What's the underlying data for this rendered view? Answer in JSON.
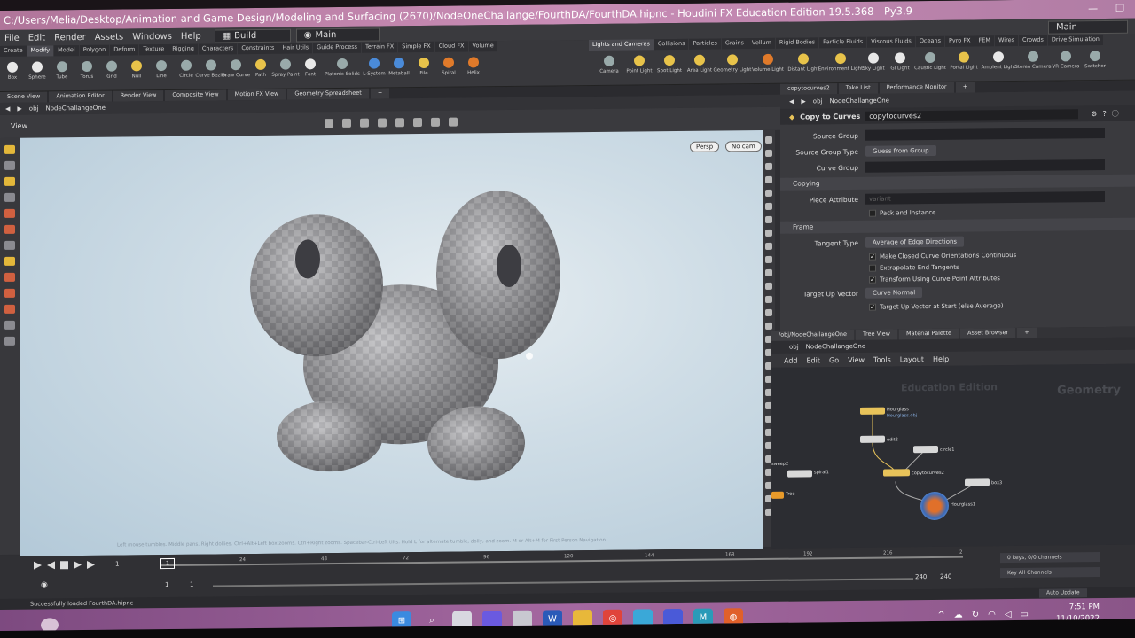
{
  "window": {
    "title": "C:/Users/Melia/Desktop/Animation and Game Design/Modeling and Surfacing (2670)/NodeOneChallange/FourthDA/FourthDA.hipnc - Houdini FX Education Edition 19.5.368 - Py3.9"
  },
  "menu": {
    "items": [
      "File",
      "Edit",
      "Render",
      "Assets",
      "Windows",
      "Help"
    ],
    "desktop_label": "Build",
    "desktop2_label": "Main",
    "right_label": "Main"
  },
  "shelf": {
    "left_tabs": [
      "Create",
      "Modify",
      "Model",
      "Polygon",
      "Deform",
      "Texture",
      "Rigging",
      "Characters",
      "Constraints",
      "Hair Utils",
      "Guide Process",
      "Terrain FX",
      "Simple FX",
      "Cloud FX",
      "Volume"
    ],
    "left_tools": [
      "Box",
      "Sphere",
      "Tube",
      "Torus",
      "Grid",
      "Null",
      "Line",
      "Circle",
      "Curve Bezier",
      "Draw Curve",
      "Path",
      "Spray Paint",
      "Font",
      "Platonic Solids",
      "L-System",
      "Metaball",
      "File",
      "Spiral",
      "Helix"
    ],
    "right_tabs": [
      "Lights and Cameras",
      "Collisions",
      "Particles",
      "Grains",
      "Vellum",
      "Rigid Bodies",
      "Particle Fluids",
      "Viscous Fluids",
      "Oceans",
      "Pyro FX",
      "FEM",
      "Wires",
      "Crowds",
      "Drive Simulation"
    ],
    "right_tools": [
      "Camera",
      "Point Light",
      "Spot Light",
      "Area Light",
      "Geometry Light",
      "Volume Light",
      "Distant Light",
      "Environment Light",
      "Sky Light",
      "GI Light",
      "Caustic Light",
      "Portal Light",
      "Ambient Light",
      "Stereo Camera",
      "VR Camera",
      "Switcher"
    ]
  },
  "panetabs": [
    "Scene View",
    "Animation Editor",
    "Render View",
    "Composite View",
    "Motion FX View",
    "Geometry Spreadsheet"
  ],
  "path": {
    "context": "obj",
    "node": "NodeChallangeOne"
  },
  "viewport": {
    "label": "View",
    "persp": "Persp",
    "cam": "No cam",
    "hint": "Left mouse tumbles. Middle pans. Right dollies. Ctrl+Alt+Left box zooms. Ctrl+Right zooms. Spacebar-Ctrl-Left tilts. Hold L for alternate tumble, dolly, and zoom.    M or Alt+M for First Person Navigation."
  },
  "parms": {
    "tabs": [
      "copytocurves2",
      "Take List",
      "Performance Monitor"
    ],
    "path_context": "obj",
    "path_node": "NodeChallangeOne",
    "node_type": "Copy to Curves",
    "node_name": "copytocurves2",
    "source_group_label": "Source Group",
    "source_group_type_label": "Source Group Type",
    "source_group_type_value": "Guess from Group",
    "curve_group_label": "Curve Group",
    "section_copying": "Copying",
    "piece_attribute_label": "Piece Attribute",
    "piece_attribute_value": "variant",
    "pack_instance": "Pack and Instance",
    "section_frame": "Frame",
    "tangent_type_label": "Tangent Type",
    "tangent_type_value": "Average of Edge Directions",
    "cb1": "Make Closed Curve Orientations Continuous",
    "cb2": "Extrapolate End Tangents",
    "cb3": "Transform Using Curve Point Attributes",
    "target_up_label": "Target Up Vector",
    "target_up_value": "Curve Normal",
    "cb4": "Target Up Vector at Start (else Average)"
  },
  "network": {
    "tabs": [
      "/obj/NodeChallangeOne",
      "Tree View",
      "Material Palette",
      "Asset Browser"
    ],
    "path_context": "obj",
    "path_node": "NodeChallangeOne",
    "menu": [
      "Add",
      "Edit",
      "Go",
      "View",
      "Tools",
      "Layout",
      "Help"
    ],
    "watermark1": "Education Edition",
    "watermark2": "Geometry",
    "nodes": {
      "file": "Hourglass",
      "file_sub": "Hourglass.obj",
      "edit": "edit2",
      "circle": "circle1",
      "copy": "copytocurves2",
      "spiral": "spiral1",
      "box": "box3",
      "hg": "Hourglass1",
      "tree": "Tree",
      "sweep": "sweep2"
    }
  },
  "timeline": {
    "current": "1",
    "ticks": [
      "24",
      "48",
      "72",
      "96",
      "120",
      "144",
      "168",
      "192",
      "216",
      "2"
    ],
    "start": "1",
    "start2": "1",
    "end": "240",
    "end2": "240",
    "keys": "0 keys, 0/0 channels",
    "key_all": "Key All Channels",
    "auto_update": "Auto Update"
  },
  "status": "Successfully loaded FourthDA.hipnc",
  "clock": {
    "time": "7:51 PM",
    "date": "11/10/2022"
  }
}
